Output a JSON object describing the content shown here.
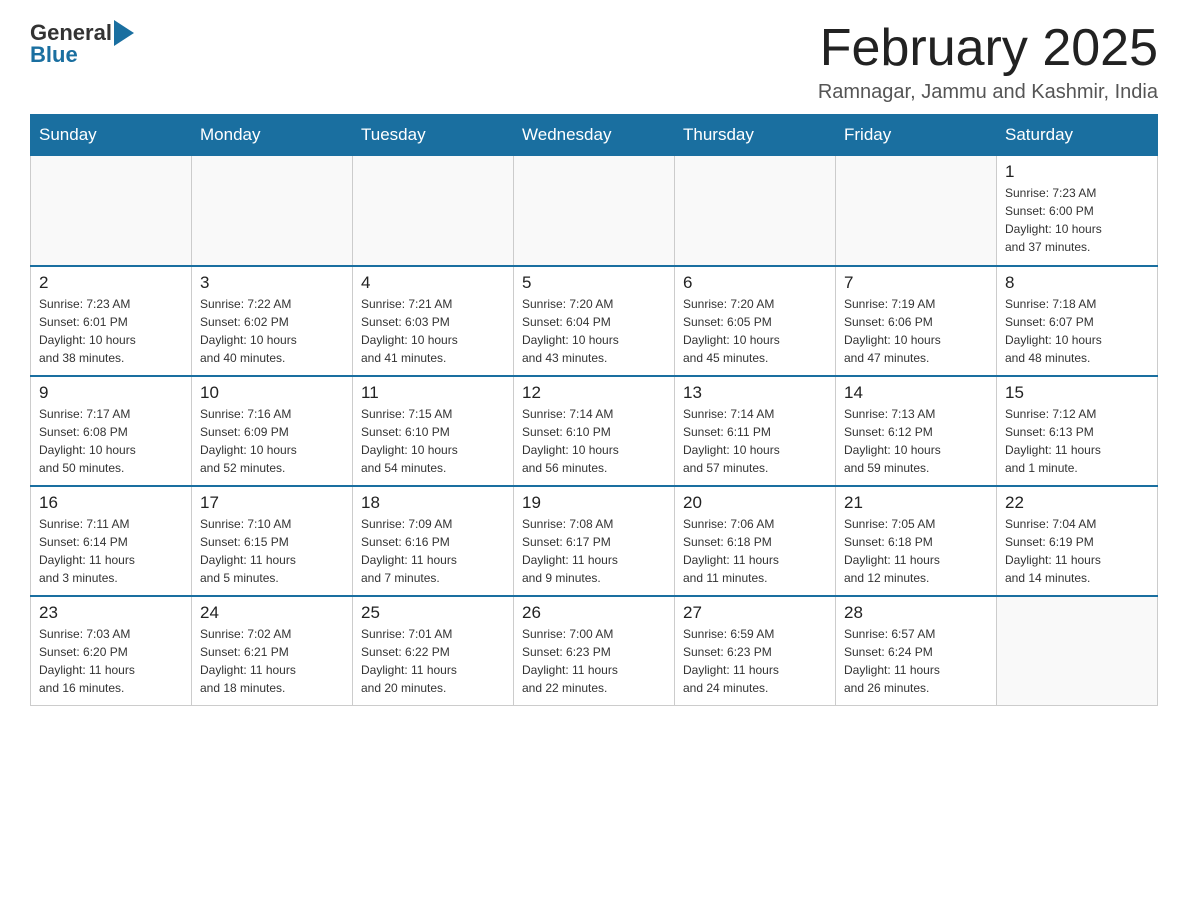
{
  "header": {
    "logo_general": "General",
    "logo_blue": "Blue",
    "title": "February 2025",
    "subtitle": "Ramnagar, Jammu and Kashmir, India"
  },
  "days_of_week": [
    "Sunday",
    "Monday",
    "Tuesday",
    "Wednesday",
    "Thursday",
    "Friday",
    "Saturday"
  ],
  "weeks": [
    {
      "days": [
        {
          "num": "",
          "info": ""
        },
        {
          "num": "",
          "info": ""
        },
        {
          "num": "",
          "info": ""
        },
        {
          "num": "",
          "info": ""
        },
        {
          "num": "",
          "info": ""
        },
        {
          "num": "",
          "info": ""
        },
        {
          "num": "1",
          "info": "Sunrise: 7:23 AM\nSunset: 6:00 PM\nDaylight: 10 hours\nand 37 minutes."
        }
      ]
    },
    {
      "days": [
        {
          "num": "2",
          "info": "Sunrise: 7:23 AM\nSunset: 6:01 PM\nDaylight: 10 hours\nand 38 minutes."
        },
        {
          "num": "3",
          "info": "Sunrise: 7:22 AM\nSunset: 6:02 PM\nDaylight: 10 hours\nand 40 minutes."
        },
        {
          "num": "4",
          "info": "Sunrise: 7:21 AM\nSunset: 6:03 PM\nDaylight: 10 hours\nand 41 minutes."
        },
        {
          "num": "5",
          "info": "Sunrise: 7:20 AM\nSunset: 6:04 PM\nDaylight: 10 hours\nand 43 minutes."
        },
        {
          "num": "6",
          "info": "Sunrise: 7:20 AM\nSunset: 6:05 PM\nDaylight: 10 hours\nand 45 minutes."
        },
        {
          "num": "7",
          "info": "Sunrise: 7:19 AM\nSunset: 6:06 PM\nDaylight: 10 hours\nand 47 minutes."
        },
        {
          "num": "8",
          "info": "Sunrise: 7:18 AM\nSunset: 6:07 PM\nDaylight: 10 hours\nand 48 minutes."
        }
      ]
    },
    {
      "days": [
        {
          "num": "9",
          "info": "Sunrise: 7:17 AM\nSunset: 6:08 PM\nDaylight: 10 hours\nand 50 minutes."
        },
        {
          "num": "10",
          "info": "Sunrise: 7:16 AM\nSunset: 6:09 PM\nDaylight: 10 hours\nand 52 minutes."
        },
        {
          "num": "11",
          "info": "Sunrise: 7:15 AM\nSunset: 6:10 PM\nDaylight: 10 hours\nand 54 minutes."
        },
        {
          "num": "12",
          "info": "Sunrise: 7:14 AM\nSunset: 6:10 PM\nDaylight: 10 hours\nand 56 minutes."
        },
        {
          "num": "13",
          "info": "Sunrise: 7:14 AM\nSunset: 6:11 PM\nDaylight: 10 hours\nand 57 minutes."
        },
        {
          "num": "14",
          "info": "Sunrise: 7:13 AM\nSunset: 6:12 PM\nDaylight: 10 hours\nand 59 minutes."
        },
        {
          "num": "15",
          "info": "Sunrise: 7:12 AM\nSunset: 6:13 PM\nDaylight: 11 hours\nand 1 minute."
        }
      ]
    },
    {
      "days": [
        {
          "num": "16",
          "info": "Sunrise: 7:11 AM\nSunset: 6:14 PM\nDaylight: 11 hours\nand 3 minutes."
        },
        {
          "num": "17",
          "info": "Sunrise: 7:10 AM\nSunset: 6:15 PM\nDaylight: 11 hours\nand 5 minutes."
        },
        {
          "num": "18",
          "info": "Sunrise: 7:09 AM\nSunset: 6:16 PM\nDaylight: 11 hours\nand 7 minutes."
        },
        {
          "num": "19",
          "info": "Sunrise: 7:08 AM\nSunset: 6:17 PM\nDaylight: 11 hours\nand 9 minutes."
        },
        {
          "num": "20",
          "info": "Sunrise: 7:06 AM\nSunset: 6:18 PM\nDaylight: 11 hours\nand 11 minutes."
        },
        {
          "num": "21",
          "info": "Sunrise: 7:05 AM\nSunset: 6:18 PM\nDaylight: 11 hours\nand 12 minutes."
        },
        {
          "num": "22",
          "info": "Sunrise: 7:04 AM\nSunset: 6:19 PM\nDaylight: 11 hours\nand 14 minutes."
        }
      ]
    },
    {
      "days": [
        {
          "num": "23",
          "info": "Sunrise: 7:03 AM\nSunset: 6:20 PM\nDaylight: 11 hours\nand 16 minutes."
        },
        {
          "num": "24",
          "info": "Sunrise: 7:02 AM\nSunset: 6:21 PM\nDaylight: 11 hours\nand 18 minutes."
        },
        {
          "num": "25",
          "info": "Sunrise: 7:01 AM\nSunset: 6:22 PM\nDaylight: 11 hours\nand 20 minutes."
        },
        {
          "num": "26",
          "info": "Sunrise: 7:00 AM\nSunset: 6:23 PM\nDaylight: 11 hours\nand 22 minutes."
        },
        {
          "num": "27",
          "info": "Sunrise: 6:59 AM\nSunset: 6:23 PM\nDaylight: 11 hours\nand 24 minutes."
        },
        {
          "num": "28",
          "info": "Sunrise: 6:57 AM\nSunset: 6:24 PM\nDaylight: 11 hours\nand 26 minutes."
        },
        {
          "num": "",
          "info": ""
        }
      ]
    }
  ]
}
